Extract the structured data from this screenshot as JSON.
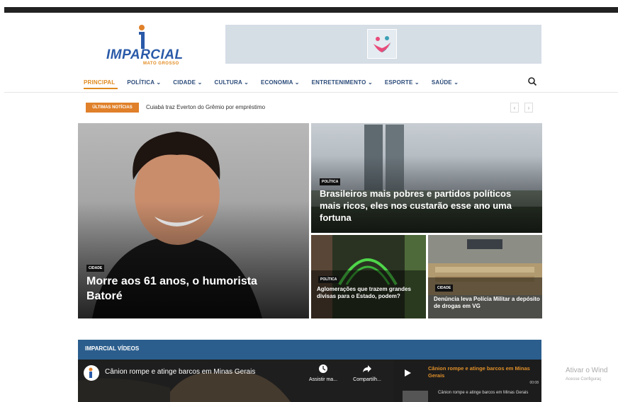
{
  "logo": {
    "brand": "IMPARCIAL",
    "sub": "MATO GROSSO"
  },
  "nav": {
    "items": [
      "PRINCIPAL",
      "POLÍTICA ⌄",
      "CIDADE ⌄",
      "CULTURA ⌄",
      "ECONOMIA ⌄",
      "ENTRETENIMENTO ⌄",
      "ESPORTE ⌄",
      "SAÚDE ⌄"
    ],
    "search_icon": "search-icon"
  },
  "ticker": {
    "badge": "ÚLTIMAS NOTÍCIAS",
    "headline": "Cuiabá traz Everton do Grêmio por empréstimo",
    "prev": "‹",
    "next": "›"
  },
  "featured": {
    "main": {
      "category": "CIDADE",
      "title": "Morre aos 61 anos, o humorista Batoré"
    },
    "right_top": {
      "category": "POLÍTICA",
      "title": "Brasileiros mais pobres e partidos políticos mais ricos, eles nos custarão esse ano uma fortuna"
    },
    "bottom_left": {
      "category": "POLÍTICA",
      "title": "Aglomerações que trazem grandes divisas para o Estado, podem?"
    },
    "bottom_right": {
      "category": "CIDADE",
      "title": "Denúncia leva Polícia Militar a depósito de drogas em VG"
    }
  },
  "videos": {
    "header": "IMPARCIAL VÍDEOS",
    "player_title": "Cânion rompe e atinge barcos em Minas Gerais",
    "watch_later": "Assistir ma...",
    "share": "Compartilh...",
    "playlist_title": "Cânion rompe e atinge barcos em Minas Gerais",
    "playlist_time": "00:08",
    "playlist_item": "Cânion rompe e atinge barcos em Minas Gerais"
  },
  "watermark": {
    "line1": "Ativar o Wind",
    "line2": "Acesse Configuraç"
  },
  "colors": {
    "accent": "#e08a1e",
    "brand_blue": "#2a4a78",
    "video_header": "#2b5e8d"
  }
}
